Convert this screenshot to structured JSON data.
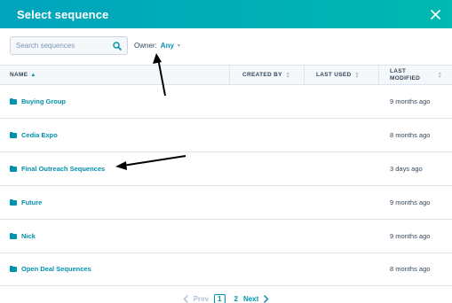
{
  "header": {
    "title": "Select sequence"
  },
  "search": {
    "placeholder": "Search sequences"
  },
  "owner": {
    "label": "Owner:",
    "value": "Any"
  },
  "columns": {
    "name": "NAME",
    "created_by": "CREATED BY",
    "last_used": "LAST USED",
    "last_modified_line1": "LAST",
    "last_modified_line2": "MODIFIED"
  },
  "rows": [
    {
      "name": "Buying Group",
      "last_modified": "9 months ago"
    },
    {
      "name": "Cedia Expo",
      "last_modified": "8 months ago"
    },
    {
      "name": "Final Outreach Sequences",
      "last_modified": "3 days ago"
    },
    {
      "name": "Future",
      "last_modified": "9 months ago"
    },
    {
      "name": "Nick",
      "last_modified": "9 months ago"
    },
    {
      "name": "Open Deal Sequences",
      "last_modified": "8 months ago"
    }
  ],
  "pagination": {
    "prev": "Prev",
    "current": "1",
    "page2": "2",
    "next": "Next"
  },
  "colors": {
    "accent": "#0091ae",
    "header_start": "#00a4bd",
    "header_end": "#00b9b0",
    "text": "#33475b"
  },
  "icons": [
    "close-icon",
    "search-icon",
    "folder-icon",
    "sort-arrow-icon",
    "chevron-left-icon",
    "chevron-right-icon"
  ]
}
